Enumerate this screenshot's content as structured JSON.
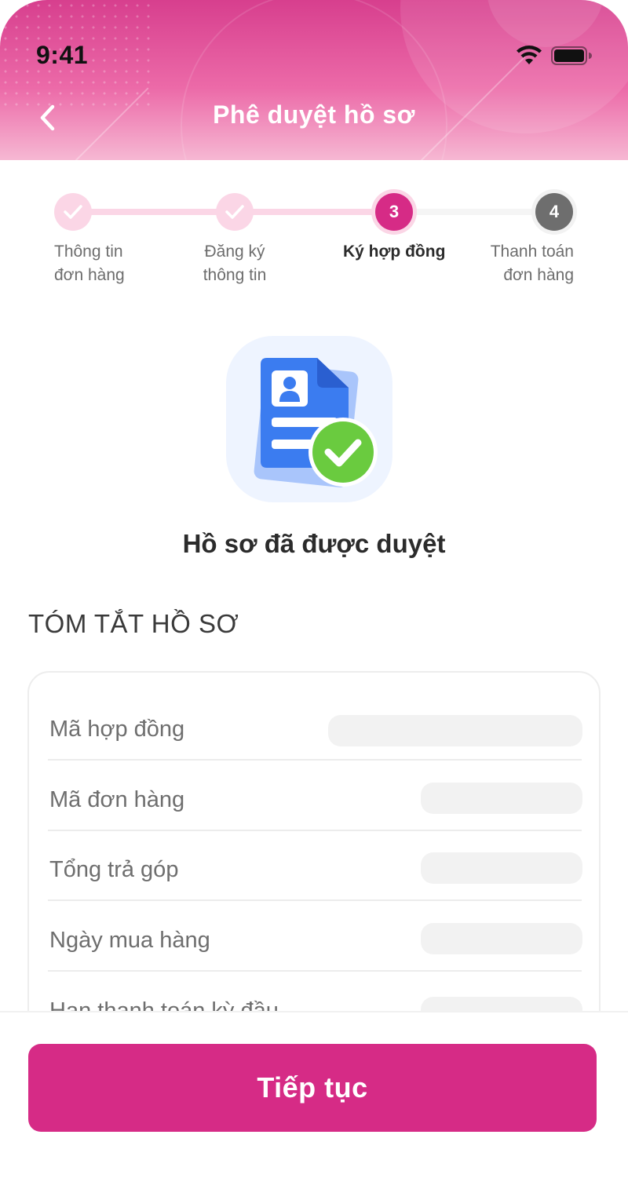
{
  "status_bar": {
    "time": "9:41",
    "wifi_icon": "wifi-icon",
    "battery_icon": "battery-full-icon"
  },
  "nav": {
    "back_icon": "chevron-left-icon",
    "title": "Phê duyệt hồ sơ"
  },
  "stepper": {
    "current_step": 3,
    "steps": [
      {
        "line1": "Thông tin",
        "line2": "đơn hàng",
        "state": "done",
        "icon": "check-icon"
      },
      {
        "line1": "Đăng ký",
        "line2": "thông tin",
        "state": "done",
        "icon": "check-icon"
      },
      {
        "number": "3",
        "line1": "Ký hợp đồng",
        "line2": "",
        "state": "active"
      },
      {
        "number": "4",
        "line1": "Thanh toán",
        "line2": "đơn hàng",
        "state": "todo"
      }
    ]
  },
  "status": {
    "illustration_icon": "approved-document-icon",
    "title": "Hồ sơ đã được duyệt"
  },
  "summary": {
    "heading": "TÓM TẮT HỒ SƠ",
    "rows": [
      {
        "label": "Mã hợp đồng",
        "value": ""
      },
      {
        "label": "Mã đơn hàng",
        "value": ""
      },
      {
        "label": "Tổng trả góp",
        "value": ""
      },
      {
        "label": "Ngày mua hàng",
        "value": ""
      },
      {
        "label": "Hạn thanh toán kỳ đầu",
        "value": ""
      }
    ]
  },
  "footer": {
    "continue_label": "Tiếp tục"
  },
  "colors": {
    "primary": "#d62b86",
    "step_done": "#fbd6e6",
    "step_todo": "#6e6e6e",
    "success": "#6acb3f",
    "document_blue": "#3b7cf0"
  }
}
